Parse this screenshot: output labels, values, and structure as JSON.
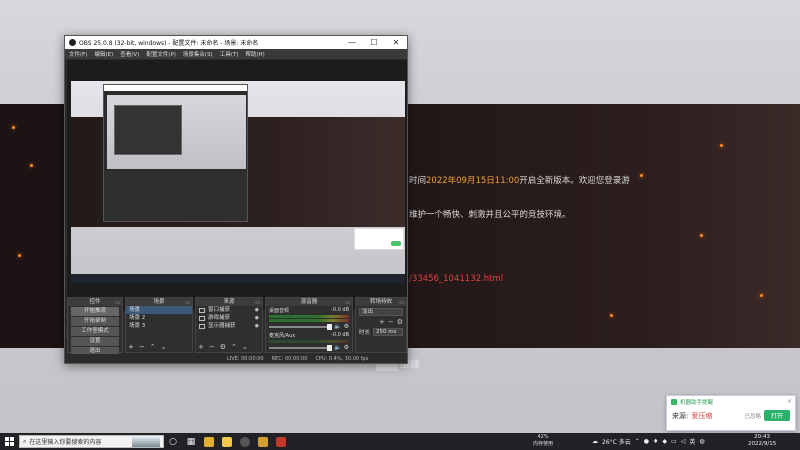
{
  "obs": {
    "title": "OBS 25.0.8 (32-bit, windows) - 配置文件: 未命名 - 场景: 未命名",
    "window_buttons": [
      "—",
      "☐",
      "✕"
    ],
    "menu": [
      "文件(F)",
      "编辑(E)",
      "查看(V)",
      "配置文件(P)",
      "场景集合(S)",
      "工具(T)",
      "帮助(H)"
    ],
    "docks": {
      "controls_title": "控件",
      "controls": [
        "开始推流",
        "开始录制",
        "工作室模式",
        "设置",
        "退出"
      ],
      "scenes_title": "场景",
      "scenes": [
        "场景",
        "场景 2",
        "场景 3"
      ],
      "sources_title": "来源",
      "sources": [
        "窗口捕获",
        "游戏捕获",
        "显示器捕获"
      ],
      "mixer_title": "混音器",
      "mixer": [
        {
          "name": "桌面音频",
          "db": "-0.0 dB"
        },
        {
          "name": "麦克风/Aux",
          "db": "-0.0 dB"
        }
      ],
      "transitions_title": "转场特效",
      "transition_value": "淡出",
      "duration_label": "时长",
      "duration_value": "250 ms"
    },
    "status": {
      "live": "LIVE: 00:00:00",
      "rec": "REC: 00:00:00",
      "cpu": "CPU: 0.4%, 30.00 fps"
    }
  },
  "banner": {
    "line1_time_prefix": "时间",
    "line1_time": "2022年09月15日11:00",
    "line1_rest": "开启全新版本。欢迎您登录游",
    "line2": "维护一个畅快、刺激并且公平的竞技环境。",
    "link": "/33456_1041132.html",
    "continue_text": "继续"
  },
  "notification": {
    "app": "机器助手提醒",
    "source_label": "来源:",
    "source_name": "爱压缩",
    "ignore": "已忽略",
    "action": "打开"
  },
  "taskbar": {
    "search_placeholder": "在这里输入你要搜索的内容",
    "mem_percent": "42%",
    "mem_label": "内存使用",
    "weather": "26°C 多云",
    "ime": "英",
    "time": "20:43",
    "date": "2022/9/15"
  }
}
